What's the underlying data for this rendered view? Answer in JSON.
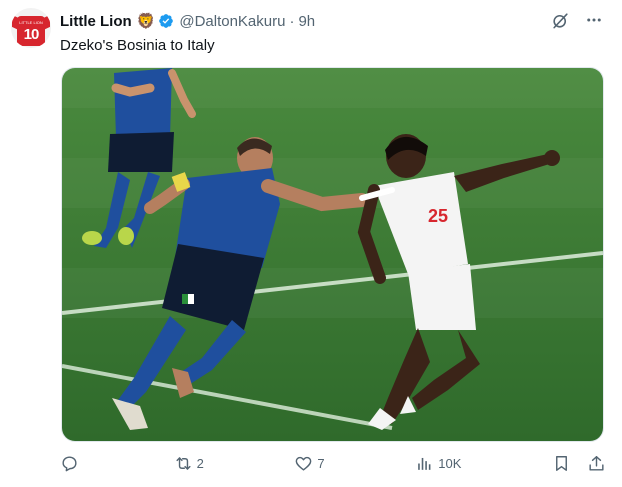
{
  "author": {
    "name": "Little Lion",
    "emoji": "🦁",
    "handle": "@DaltonKakuru",
    "separator": "·",
    "time": "9h",
    "avatar_number": "10",
    "avatar_text": "LITTLE LION"
  },
  "tweet": {
    "text": "Dzeko's Bosinia to Italy"
  },
  "media": {
    "left_player_number": "",
    "right_player_number": "25"
  },
  "actions": {
    "reply_count": "",
    "retweet_count": "2",
    "like_count": "7",
    "views_count": "10K"
  },
  "colors": {
    "accent": "#1d9bf0",
    "muted": "#536471",
    "pitch": "#3f7a36",
    "italy_blue": "#1f4f9e",
    "england_white": "#f4f4f4",
    "avatar_red": "#d7262e"
  },
  "icons": [
    "verified-badge-icon",
    "grok-icon",
    "more-icon",
    "reply-icon",
    "retweet-icon",
    "like-icon",
    "views-icon",
    "bookmark-icon",
    "share-icon"
  ]
}
